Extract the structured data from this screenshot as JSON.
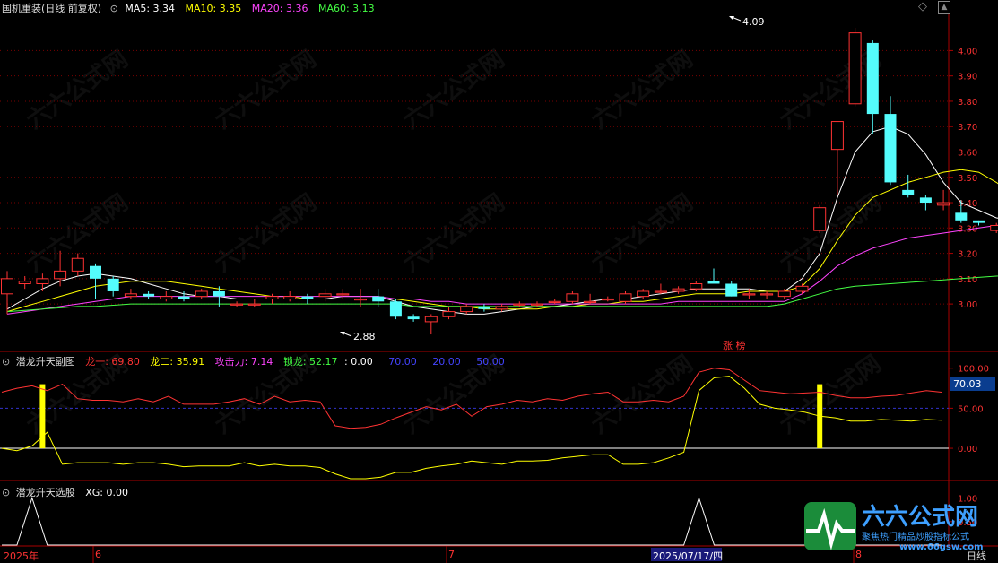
{
  "window": {
    "title": "国机重装(日线 前复权)",
    "menu_icon": "chevron-down-icon",
    "top_right_icons": [
      "diamond-icon",
      "scroll-up-icon"
    ]
  },
  "main_header": {
    "ma5": {
      "label": "MA5: 3.34",
      "color": "#ffffff"
    },
    "ma10": {
      "label": "MA10: 3.35",
      "color": "#ffff00"
    },
    "ma20": {
      "label": "MA20: 3.36",
      "color": "#ff44ff"
    },
    "ma60": {
      "label": "MA60: 3.13",
      "color": "#44ff44"
    }
  },
  "price_annotations": {
    "high": "4.09",
    "low": "2.88",
    "badge": "涨 榜"
  },
  "sub1_header": {
    "title": "潜龙升天副图",
    "long1": {
      "label": "龙一: 69.80",
      "color": "#ff3333"
    },
    "long2": {
      "label": "龙二: 35.91",
      "color": "#ffff00"
    },
    "attack": {
      "label": "攻击力: 7.14",
      "color": "#ff44ff"
    },
    "lock": {
      "label": "锁龙: 52.17",
      "color": "#44ff44"
    },
    "v0": {
      "label": ": 0.00",
      "color": "#ffffff"
    },
    "v70": {
      "label": "70.00",
      "color": "#4444ff"
    },
    "v20": {
      "label": "20.00",
      "color": "#4444ff"
    },
    "v50": {
      "label": "50.00",
      "color": "#4444ff"
    },
    "current_value": "70.03"
  },
  "sub2_header": {
    "title": "潜龙升天选股",
    "xg": "XG: 0.00"
  },
  "date_axis": {
    "labels": [
      "2025年",
      "6",
      "7",
      "2025/07/17/四",
      "8"
    ],
    "period": "日线"
  },
  "logo": {
    "brand": "六六公式网",
    "slogan": "聚焦热门精品炒股指标公式",
    "url": "www.66gsw.com"
  },
  "colors": {
    "up": "#ff3333",
    "down": "#54fcfc",
    "grid": "#7a0000",
    "axis": "#aa0000"
  },
  "chart_data": [
    {
      "type": "candlestick",
      "ylim": [
        2.82,
        4.15
      ],
      "yticks": [
        4.0,
        3.9,
        3.8,
        3.7,
        3.6,
        3.5,
        3.4,
        3.3,
        3.2,
        3.1,
        3.0
      ],
      "ytick_labels": [
        "4.00",
        "3.90",
        "3.80",
        "3.70",
        "3.60",
        "3.50",
        "3.40",
        "3.30",
        "3.20",
        "3.10",
        "3.00"
      ],
      "candles": [
        [
          3.04,
          3.1,
          3.13,
          2.96
        ],
        [
          3.08,
          3.09,
          3.11,
          3.06
        ],
        [
          3.08,
          3.1,
          3.12,
          3.05
        ],
        [
          3.1,
          3.13,
          3.21,
          3.07
        ],
        [
          3.13,
          3.18,
          3.2,
          3.11
        ],
        [
          3.15,
          3.1,
          3.16,
          3.02
        ],
        [
          3.1,
          3.05,
          3.11,
          3.03
        ],
        [
          3.03,
          3.04,
          3.06,
          3.02
        ],
        [
          3.04,
          3.03,
          3.05,
          3.02
        ],
        [
          3.02,
          3.03,
          3.05,
          3.01
        ],
        [
          3.03,
          3.02,
          3.05,
          3.01
        ],
        [
          3.03,
          3.05,
          3.06,
          3.02
        ],
        [
          3.05,
          3.03,
          3.07,
          2.99
        ],
        [
          3.0,
          3.0,
          3.01,
          2.99
        ],
        [
          3.0,
          3.0,
          3.02,
          2.99
        ],
        [
          3.02,
          3.03,
          3.04,
          3.0
        ],
        [
          3.02,
          3.03,
          3.05,
          3.01
        ],
        [
          3.03,
          3.02,
          3.04,
          3.0
        ],
        [
          3.03,
          3.04,
          3.06,
          3.01
        ],
        [
          3.04,
          3.04,
          3.06,
          3.02
        ],
        [
          3.02,
          3.02,
          3.06,
          2.99
        ],
        [
          3.03,
          3.01,
          3.06,
          2.99
        ],
        [
          3.01,
          2.95,
          3.02,
          2.94
        ],
        [
          2.95,
          2.94,
          2.96,
          2.93
        ],
        [
          2.93,
          2.95,
          2.96,
          2.88
        ],
        [
          2.95,
          2.97,
          2.99,
          2.94
        ],
        [
          2.97,
          2.99,
          3.0,
          2.96
        ],
        [
          2.99,
          2.98,
          3.0,
          2.97
        ],
        [
          2.98,
          2.99,
          3.0,
          2.97
        ],
        [
          3.0,
          3.0,
          3.01,
          2.99
        ],
        [
          3.0,
          3.0,
          3.01,
          2.99
        ],
        [
          3.01,
          3.01,
          3.02,
          3.0
        ],
        [
          3.01,
          3.04,
          3.05,
          3.0
        ],
        [
          3.01,
          3.01,
          3.04,
          3.0
        ],
        [
          3.02,
          3.02,
          3.03,
          3.01
        ],
        [
          3.01,
          3.04,
          3.05,
          3.0
        ],
        [
          3.03,
          3.05,
          3.06,
          3.02
        ],
        [
          3.05,
          3.05,
          3.08,
          3.04
        ],
        [
          3.05,
          3.06,
          3.07,
          3.04
        ],
        [
          3.06,
          3.08,
          3.09,
          3.05
        ],
        [
          3.09,
          3.08,
          3.14,
          3.08
        ],
        [
          3.08,
          3.03,
          3.09,
          3.03
        ],
        [
          3.04,
          3.04,
          3.06,
          3.02
        ],
        [
          3.04,
          3.04,
          3.05,
          3.02
        ],
        [
          3.03,
          3.05,
          3.06,
          3.02
        ],
        [
          3.05,
          3.07,
          3.08,
          3.04
        ],
        [
          3.29,
          3.38,
          3.39,
          3.28
        ],
        [
          3.61,
          3.72,
          3.72,
          3.43
        ],
        [
          3.79,
          4.07,
          4.09,
          3.78
        ],
        [
          4.03,
          3.75,
          4.04,
          3.67
        ],
        [
          3.75,
          3.48,
          3.82,
          3.47
        ],
        [
          3.45,
          3.43,
          3.51,
          3.42
        ],
        [
          3.42,
          3.4,
          3.43,
          3.37
        ],
        [
          3.39,
          3.4,
          3.45,
          3.37
        ],
        [
          3.36,
          3.33,
          3.41,
          3.32
        ],
        [
          3.33,
          3.32,
          3.33,
          3.31
        ],
        [
          3.29,
          3.31,
          3.32,
          3.28
        ],
        [
          3.33,
          3.33,
          3.34,
          3.31
        ],
        [
          3.33,
          3.34,
          3.35,
          3.32
        ],
        [
          3.35,
          3.33,
          3.36,
          3.29
        ],
        [
          3.31,
          3.38,
          3.41,
          3.31
        ]
      ],
      "series": [
        {
          "name": "MA5",
          "color": "#ffffff",
          "values": [
            2.98,
            3.02,
            3.06,
            3.09,
            3.11,
            3.12,
            3.11,
            3.1,
            3.08,
            3.06,
            3.04,
            3.03,
            3.03,
            3.02,
            3.02,
            3.02,
            3.02,
            3.02,
            3.02,
            3.03,
            3.03,
            3.03,
            3.01,
            2.99,
            2.98,
            2.97,
            2.96,
            2.96,
            2.97,
            2.98,
            2.99,
            2.99,
            3.0,
            3.01,
            3.02,
            3.02,
            3.03,
            3.04,
            3.05,
            3.06,
            3.06,
            3.06,
            3.06,
            3.05,
            3.05,
            3.1,
            3.2,
            3.42,
            3.6,
            3.68,
            3.7,
            3.67,
            3.59,
            3.48,
            3.4,
            3.37,
            3.34,
            3.33,
            3.33,
            3.33,
            3.34
          ]
        },
        {
          "name": "MA10",
          "color": "#ffff00",
          "values": [
            2.97,
            2.99,
            3.01,
            3.03,
            3.05,
            3.07,
            3.08,
            3.09,
            3.09,
            3.09,
            3.08,
            3.07,
            3.06,
            3.05,
            3.04,
            3.03,
            3.03,
            3.02,
            3.02,
            3.02,
            3.02,
            3.02,
            3.02,
            3.01,
            3.0,
            2.99,
            2.99,
            2.98,
            2.98,
            2.98,
            2.98,
            2.99,
            2.99,
            3.0,
            3.0,
            3.01,
            3.01,
            3.02,
            3.03,
            3.04,
            3.04,
            3.04,
            3.05,
            3.05,
            3.05,
            3.07,
            3.14,
            3.25,
            3.35,
            3.42,
            3.45,
            3.48,
            3.5,
            3.52,
            3.53,
            3.52,
            3.48,
            3.43,
            3.38,
            3.36,
            3.35
          ]
        },
        {
          "name": "MA20",
          "color": "#ff44ff",
          "values": [
            2.96,
            2.97,
            2.98,
            2.99,
            3.0,
            3.01,
            3.02,
            3.03,
            3.03,
            3.03,
            3.03,
            3.03,
            3.03,
            3.03,
            3.03,
            3.03,
            3.03,
            3.03,
            3.03,
            3.03,
            3.03,
            3.03,
            3.02,
            3.02,
            3.01,
            3.01,
            3.0,
            3.0,
            3.0,
            3.0,
            3.0,
            3.0,
            3.0,
            3.0,
            3.0,
            3.0,
            3.0,
            3.0,
            3.01,
            3.01,
            3.01,
            3.01,
            3.01,
            3.01,
            3.01,
            3.04,
            3.09,
            3.15,
            3.19,
            3.22,
            3.24,
            3.26,
            3.27,
            3.28,
            3.29,
            3.3,
            3.31,
            3.32,
            3.33,
            3.34,
            3.36
          ]
        },
        {
          "name": "MA60",
          "color": "#44ff44",
          "values": [
            2.97,
            2.975,
            2.98,
            2.985,
            2.99,
            2.99,
            2.995,
            3.0,
            3.0,
            3.0,
            3.0,
            3.0,
            3.0,
            3.0,
            3.0,
            3.0,
            3.0,
            3.0,
            3.0,
            3.0,
            3.0,
            3.0,
            3.0,
            2.99,
            2.99,
            2.99,
            2.99,
            2.99,
            2.99,
            2.99,
            2.99,
            2.99,
            2.99,
            2.99,
            2.99,
            2.99,
            2.99,
            2.99,
            2.99,
            2.99,
            2.99,
            2.99,
            2.99,
            2.99,
            3.0,
            3.02,
            3.04,
            3.06,
            3.07,
            3.075,
            3.08,
            3.085,
            3.09,
            3.095,
            3.1,
            3.105,
            3.11,
            3.115,
            3.12,
            3.125,
            3.13
          ]
        }
      ]
    },
    {
      "type": "line",
      "ylim": [
        -38,
        112
      ],
      "yticks": [
        100,
        50,
        0
      ],
      "ytick_labels": [
        "100.00",
        "50.00",
        "0.00"
      ],
      "hlines": [
        {
          "value": 50,
          "color": "#3333cc",
          "style": "dashed"
        },
        {
          "value": 0,
          "color": "#ffffff",
          "style": "solid"
        }
      ],
      "signal_bars": [
        {
          "index": 2,
          "from": 0,
          "to": 80
        },
        {
          "index": 46,
          "from": 0,
          "to": 80
        }
      ],
      "series": [
        {
          "name": "龙一",
          "color": "#ff3333",
          "values": [
            70,
            75,
            78,
            72,
            80,
            62,
            60,
            60,
            58,
            62,
            58,
            65,
            55,
            55,
            55,
            58,
            62,
            55,
            65,
            58,
            60,
            58,
            28,
            25,
            26,
            30,
            38,
            45,
            52,
            48,
            55,
            40,
            52,
            55,
            60,
            58,
            62,
            60,
            65,
            68,
            70,
            58,
            58,
            60,
            58,
            65,
            95,
            100,
            98,
            85,
            72,
            70,
            68,
            69,
            70,
            66,
            63,
            63,
            65,
            66,
            69,
            72,
            70
          ]
        },
        {
          "name": "龙二",
          "color": "#ffff00",
          "values": [
            0,
            -3,
            3,
            20,
            -20,
            -18,
            -18,
            -18,
            -20,
            -18,
            -18,
            -20,
            -23,
            -22,
            -22,
            -22,
            -18,
            -22,
            -20,
            -22,
            -22,
            -24,
            -32,
            -38,
            -38,
            -36,
            -30,
            -30,
            -25,
            -22,
            -20,
            -16,
            -18,
            -20,
            -16,
            -16,
            -15,
            -12,
            -10,
            -8,
            -8,
            -20,
            -20,
            -18,
            -12,
            -5,
            72,
            88,
            90,
            75,
            55,
            50,
            48,
            45,
            40,
            38,
            34,
            34,
            36,
            35,
            34,
            36,
            35
          ]
        }
      ]
    },
    {
      "type": "line",
      "ylim": [
        0,
        1.2
      ],
      "yticks": [
        1.0,
        0.5
      ],
      "ytick_labels": [
        "1.00",
        "0.50"
      ],
      "series": [
        {
          "name": "XG",
          "color": "#ffffff",
          "values": [
            0,
            0,
            1,
            0,
            0,
            0,
            0,
            0,
            0,
            0,
            0,
            0,
            0,
            0,
            0,
            0,
            0,
            0,
            0,
            0,
            0,
            0,
            0,
            0,
            0,
            0,
            0,
            0,
            0,
            0,
            0,
            0,
            0,
            0,
            0,
            0,
            0,
            0,
            0,
            0,
            0,
            0,
            0,
            0,
            0,
            0,
            1,
            0,
            0,
            0,
            0,
            0,
            0,
            0,
            0,
            0,
            0,
            0,
            0,
            0,
            0,
            0,
            0
          ]
        }
      ]
    }
  ]
}
